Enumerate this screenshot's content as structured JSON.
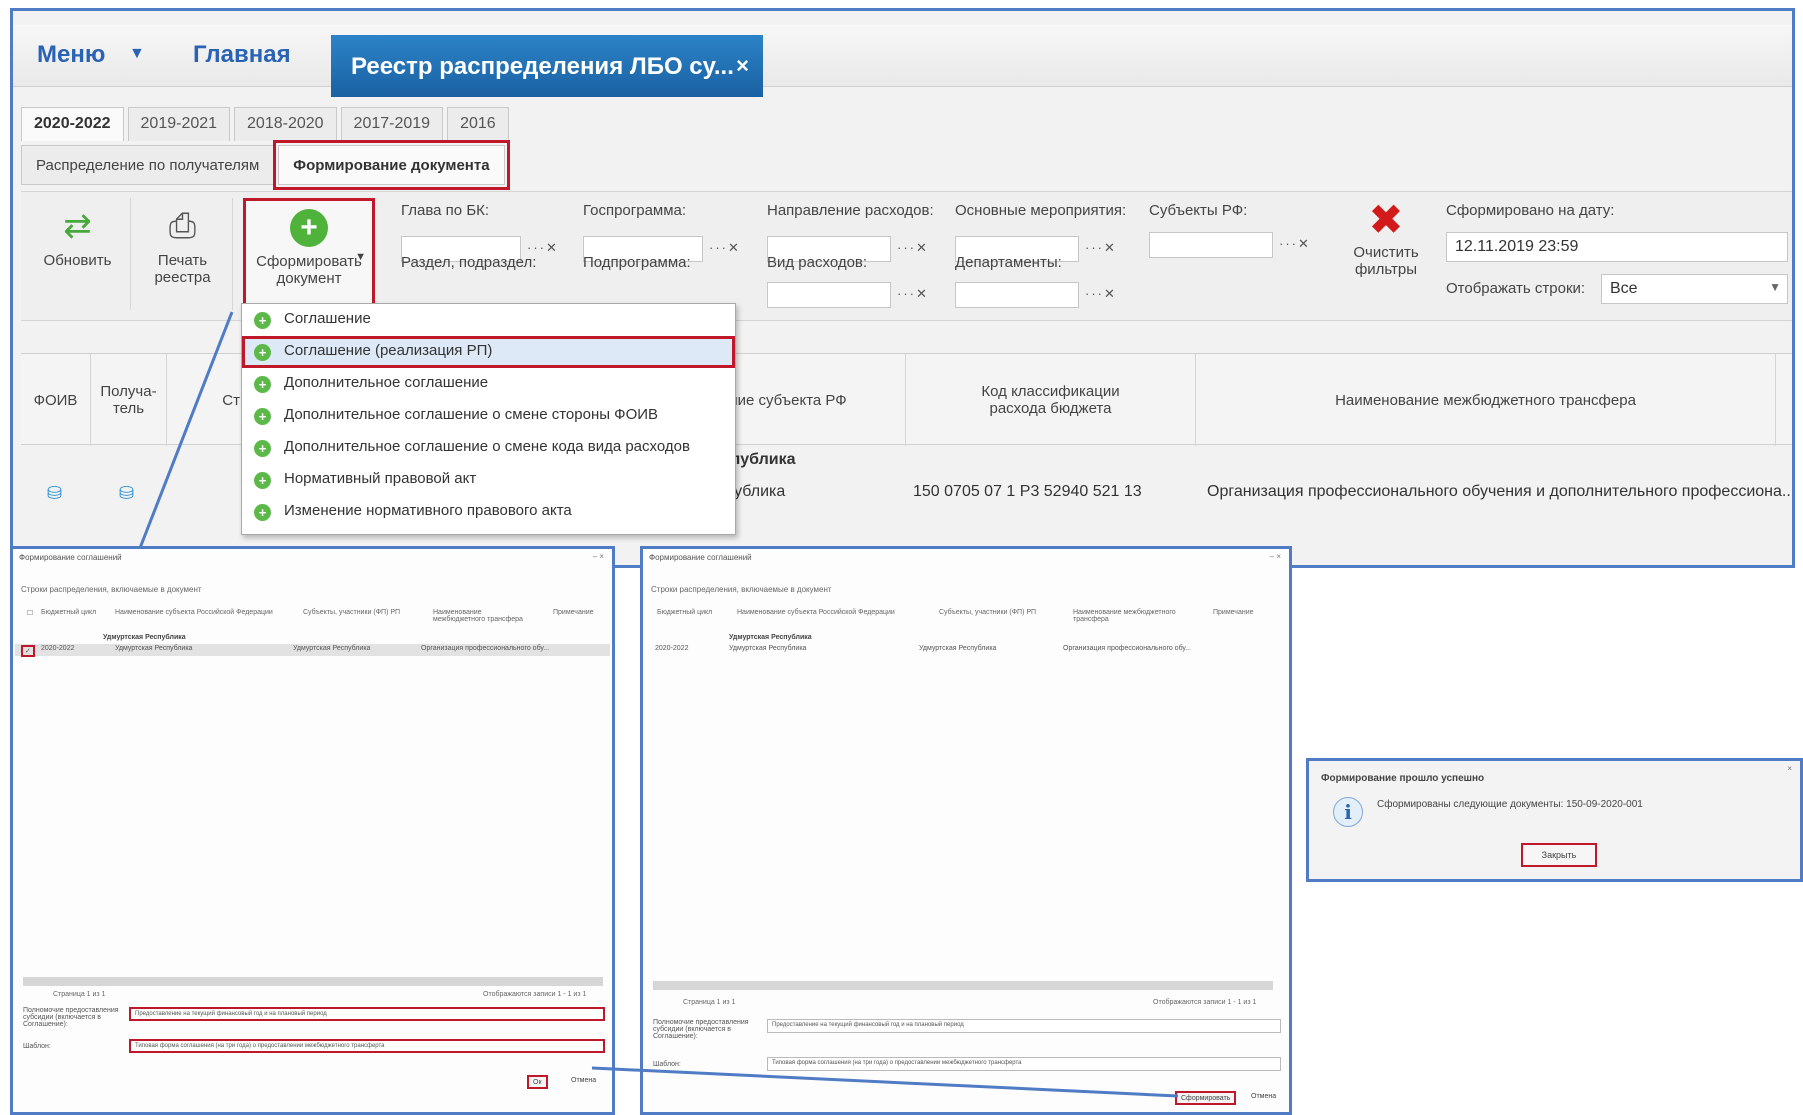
{
  "topbar": {
    "menu_label": "Меню",
    "home_label": "Главная",
    "active_tab_label": "Реестр распределения ЛБО су...",
    "active_tab_close": "×"
  },
  "year_tabs": [
    "2020-2022",
    "2019-2021",
    "2018-2020",
    "2017-2019",
    "2016"
  ],
  "subtabs": [
    "Распределение по получателям",
    "Формирование документа"
  ],
  "toolbar": {
    "refresh_label": "Обновить",
    "print_label_line1": "Печать",
    "print_label_line2": "реестра",
    "form_label_line1": "Сформировать",
    "form_label_line2": "документ",
    "clear_label_line1": "Очистить",
    "clear_label_line2": "фильтры"
  },
  "filters": {
    "glava_bk": "Глава по БК:",
    "razdel": "Раздел, подраздел:",
    "gosprogramma": "Госпрограмма:",
    "podprogramma": "Подпрограмма:",
    "napravlenie": "Направление расходов:",
    "vid_rashodov": "Вид расходов:",
    "osnovnye": "Основные мероприятия:",
    "departamenty": "Департаменты:",
    "subekty": "Субъекты РФ:",
    "date_label": "Сформировано на дату:",
    "date_value": "12.11.2019 23:59",
    "rows_label": "Отображать строки:",
    "rows_value": "Все"
  },
  "dropdown": {
    "items": [
      "Соглашение",
      "Соглашение (реализация РП)",
      "Дополнительное соглашение",
      "Дополнительное соглашение о смене стороны ФОИВ",
      "Дополнительное соглашение о смене кода вида расходов",
      "Нормативный правовой акт",
      "Изменение нормативного правового акта"
    ]
  },
  "grid": {
    "col_foiv": "ФОИВ",
    "col_poluchatel_1": "Получа-",
    "col_poluchatel_2": "тель",
    "col_status": "Ст",
    "col_subject": "ание субъекта РФ",
    "col_kbk_1": "Код классификации",
    "col_kbk_2": "расхода бюджета",
    "col_transfer": "Наименование межбюджетного трансфера",
    "group_label": "еспублика",
    "row_subject": ":публика",
    "row_kbk": "150 0705 07 1 P3 52940 521 13",
    "row_transfer": "Организация профессионального обучения и дополнительного профессиона..."
  },
  "sub1": {
    "title": "Формирование соглашений",
    "sub_title": "Строки распределения, включаемые в документ",
    "cols": [
      "Бюджетный цикл",
      "Наименование субъекта Российской Федерации",
      "Субъекты, участники (ФП) РП",
      "Наименование межбюджетного трансфера",
      "Примечание"
    ],
    "group": "Удмуртская Республика",
    "row": [
      "2020-2022",
      "Удмуртская Республика",
      "Удмуртская Республика",
      "Организация профессионального обу..."
    ],
    "pager": "Страница  1  из 1",
    "pager_right": "Отображаются записи 1 - 1 из 1",
    "field1_label": "Полномочие предоставления субсидии (включается в Соглашение):",
    "field1_value": "Предоставление на текущий финансовый год и на плановый период",
    "field2_label": "Шаблон:",
    "field2_value": "Типовая форма соглашения (на три года) о предоставлении межбюджетного трансферта",
    "ok_btn": "Ок",
    "cancel_btn": "Отмена"
  },
  "sub2": {
    "title": "Формирование соглашений",
    "sub_title": "Строки распределения, включаемые в документ",
    "cols": [
      "Бюджетный цикл",
      "Наименование субъекта Российской Федерации",
      "Субъекты, участники (ФП) РП",
      "Наименование межбюджетного трансфера",
      "Примечание"
    ],
    "group": "Удмуртская Республика",
    "row": [
      "2020-2022",
      "Удмуртская Республика",
      "Удмуртская Республика",
      "Организация профессионального обу..."
    ],
    "pager": "Страница  1  из 1",
    "pager_right": "Отображаются записи 1 - 1 из 1",
    "field1_label": "Полномочие предоставления субсидии (включается в Соглашение):",
    "field1_value": "Предоставление на текущий финансовый год и на плановый период",
    "field2_label": "Шаблон:",
    "field2_value": "Типовая форма соглашения (на три года) о предоставлении межбюджетного трансферта",
    "ok_btn": "Сформировать",
    "cancel_btn": "Отмена"
  },
  "sub3": {
    "title": "Формирование прошло успешно",
    "message": "Сформированы следующие документы: 150-09-2020-001",
    "close_btn": "Закрыть"
  },
  "colors": {
    "accent_blue": "#2a62b4",
    "tab_blue": "#1a61a3",
    "frame_blue": "#4f7cc4",
    "highlight_red": "#c0182b",
    "success_green": "#4fb23b"
  }
}
